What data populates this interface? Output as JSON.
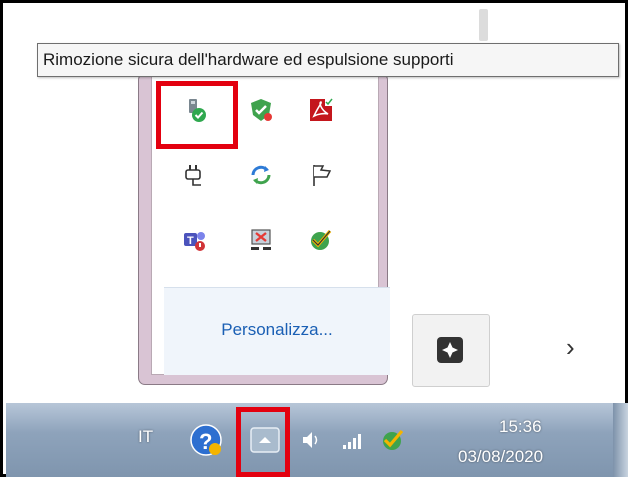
{
  "tooltip": {
    "text": "Rimozione sicura dell'hardware ed espulsione supporti"
  },
  "tray_popup": {
    "icons": [
      "safely-remove-hardware-icon",
      "green-shield-status-icon",
      "adobe-acrobat-icon",
      "power-plug-icon",
      "sync-arrows-icon",
      "action-center-flag-icon",
      "teams-icon",
      "network-disconnected-icon",
      "check-badge-icon"
    ],
    "customize_link": "Personalizza..."
  },
  "taskbar": {
    "language": "IT",
    "time": "15:36",
    "date": "03/08/2020",
    "icons": [
      "help-icon",
      "show-hidden-icons-button",
      "volume-icon",
      "signal-bars-icon",
      "check-badge-icon"
    ]
  },
  "colors": {
    "highlight": "#e3000f",
    "link": "#1a5fb4",
    "taskbar": "#8ea3bb"
  },
  "chevron": "›"
}
